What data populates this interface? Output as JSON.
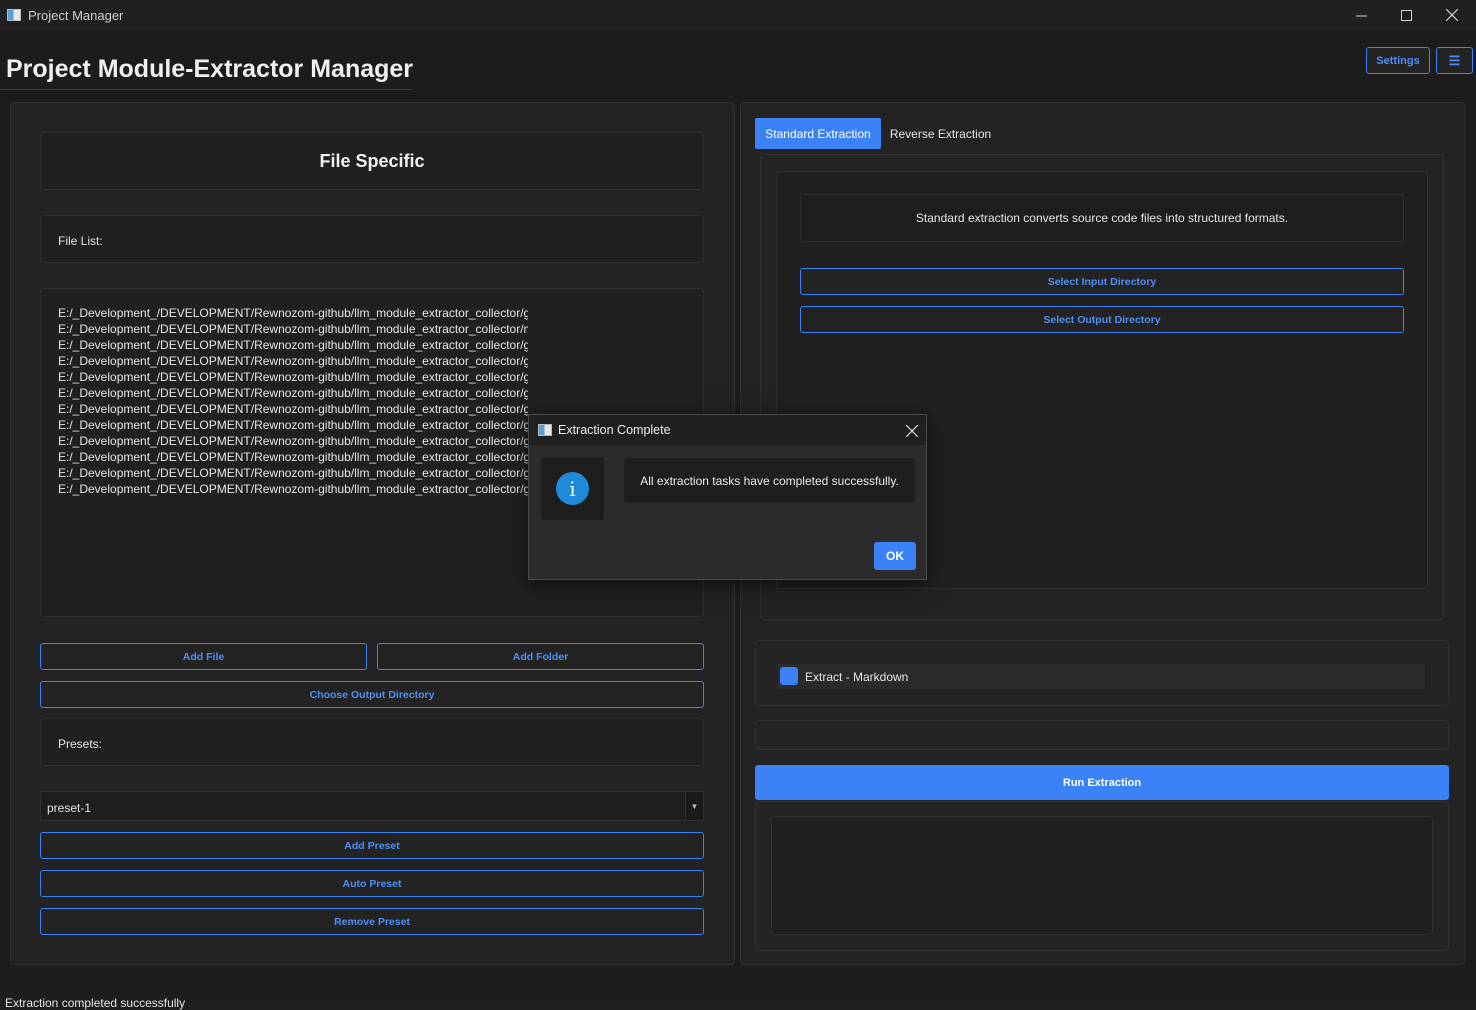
{
  "window": {
    "title": "Project Manager"
  },
  "header": {
    "title": "Project Module-Extractor Manager",
    "settings_label": "Settings",
    "menu_glyph": "☰"
  },
  "left": {
    "section_title": "File Specific",
    "file_list_label": "File List:",
    "files": [
      "E:/_Development_/DEVELOPMENT/Rewnozom-github/llm_module_extractor_collector/gui/settings_frame.py",
      "E:/_Development_/DEVELOPMENT/Rewnozom-github/llm_module_extractor_collector/main.py",
      "E:/_Development_/DEVELOPMENT/Rewnozom-github/llm_module_extractor_collector/gui/extraction_frame.py",
      "E:/_Development_/DEVELOPMENT/Rewnozom-github/llm_module_extractor_collector/gui/file_specific_frame.py",
      "E:/_Development_/DEVELOPMENT/Rewnozom-github/llm_module_extractor_collector/gui/theme_manager.py",
      "E:/_Development_/DEVELOPMENT/Rewnozom-github/llm_module_extractor_collector/gui/settings_manager.py",
      "E:/_Development_/DEVELOPMENT/Rewnozom-github/llm_module_extractor_collector/gui/constants.py",
      "E:/_Development_/DEVELOPMENT/Rewnozom-github/llm_module_extractor_collector/gu",
      "E:/_Development_/DEVELOPMENT/Rewnozom-github/llm_module_extractor_collector/gu",
      "E:/_Development_/DEVELOPMENT/Rewnozom-github/llm_module_extractor_collector/gu",
      "E:/_Development_/DEVELOPMENT/Rewnozom-github/llm_module_extractor_collector/gu",
      "E:/_Development_/DEVELOPMENT/Rewnozom-github/llm_module_extractor_collector/gu"
    ],
    "add_file_label": "Add File",
    "add_folder_label": "Add Folder",
    "choose_output_label": "Choose Output Directory",
    "presets_label": "Presets:",
    "preset_selected": "preset-1",
    "add_preset_label": "Add Preset",
    "auto_preset_label": "Auto Preset",
    "remove_preset_label": "Remove Preset"
  },
  "right": {
    "tabs": [
      {
        "label": "Standard Extraction",
        "active": true
      },
      {
        "label": "Reverse Extraction",
        "active": false
      }
    ],
    "description": "Standard extraction converts source code files into structured formats.",
    "select_input_label": "Select Input Directory",
    "select_output_label": "Select Output Directory",
    "checkbox_label": "Extract - Markdown",
    "checkbox_checked": true,
    "run_label": "Run Extraction"
  },
  "status": {
    "text": "Extraction completed successfully"
  },
  "dialog": {
    "title": "Extraction Complete",
    "icon": "info-icon",
    "message": "All extraction tasks have completed successfully.",
    "ok_label": "OK"
  },
  "colors": {
    "accent": "#3b82f6",
    "background": "#1c1c1c",
    "panel": "#232323"
  }
}
